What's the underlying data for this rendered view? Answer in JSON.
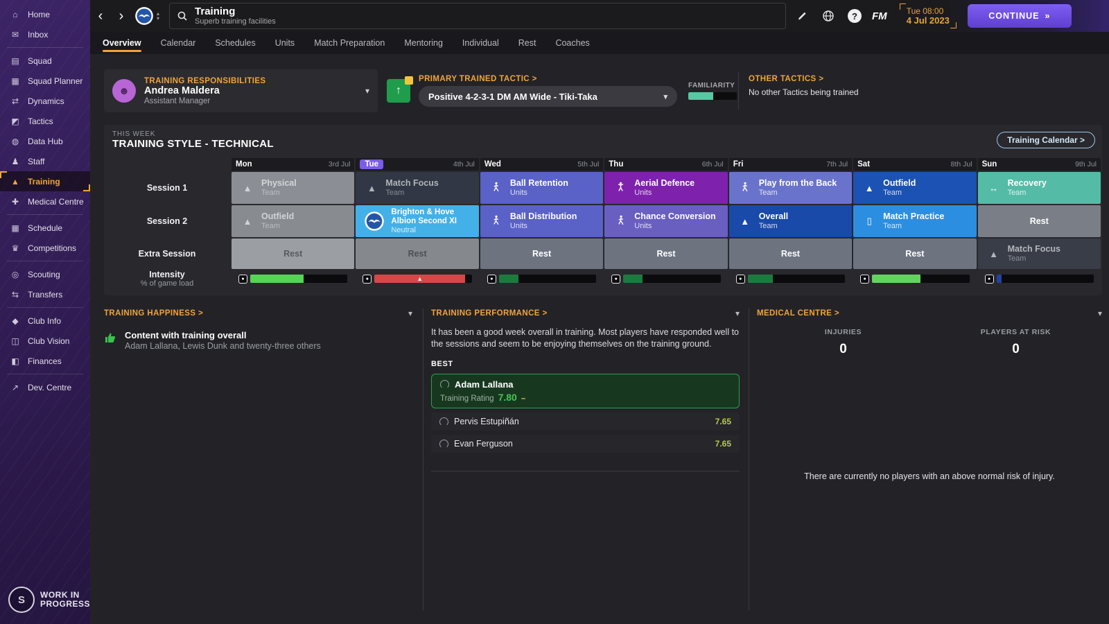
{
  "icons": {
    "back": "‹",
    "forward": "›",
    "up": "▴",
    "down": "▾",
    "chevdown": "▾",
    "cone": "▲",
    "swap": "↔",
    "tablet": "▯",
    "load": "●",
    "warn": "▲",
    "tactic_arrow": "↑",
    "avatar_people": "☻",
    "familiarity": "▪"
  },
  "sidebar": {
    "items": [
      {
        "icon": "⌂",
        "label": "Home"
      },
      {
        "icon": "✉",
        "label": "Inbox"
      },
      {
        "icon": "▤",
        "label": "Squad"
      },
      {
        "icon": "▦",
        "label": "Squad Planner"
      },
      {
        "icon": "⇄",
        "label": "Dynamics"
      },
      {
        "icon": "◩",
        "label": "Tactics"
      },
      {
        "icon": "◍",
        "label": "Data Hub"
      },
      {
        "icon": "♟",
        "label": "Staff"
      },
      {
        "icon": "▲",
        "label": "Training"
      },
      {
        "icon": "✚",
        "label": "Medical Centre"
      },
      {
        "icon": "▦",
        "label": "Schedule"
      },
      {
        "icon": "♛",
        "label": "Competitions"
      },
      {
        "icon": "◎",
        "label": "Scouting"
      },
      {
        "icon": "⇆",
        "label": "Transfers"
      },
      {
        "icon": "◆",
        "label": "Club Info"
      },
      {
        "icon": "◫",
        "label": "Club Vision"
      },
      {
        "icon": "◧",
        "label": "Finances"
      },
      {
        "icon": "↗",
        "label": "Dev. Centre"
      }
    ]
  },
  "wip": {
    "badge": "S",
    "line1": "WORK IN",
    "line2": "PROGRESS"
  },
  "topbar": {
    "title": "Training",
    "subtitle": "Superb training facilities",
    "fm_label": "FM",
    "help_label": "?",
    "clock": "Tue 08:00",
    "date": "4 Jul 2023",
    "continue_label": "CONTINUE",
    "continue_arrows": "»"
  },
  "tabs": [
    "Overview",
    "Calendar",
    "Schedules",
    "Units",
    "Match Preparation",
    "Mentoring",
    "Individual",
    "Rest",
    "Coaches"
  ],
  "responsibilities": {
    "heading": "TRAINING RESPONSIBILITIES",
    "name": "Andrea Maldera",
    "role": "Assistant Manager"
  },
  "tactic": {
    "heading": "PRIMARY TRAINED TACTIC >",
    "value": "Positive 4-2-3-1 DM AM Wide - Tiki-Taka",
    "familiarity_label": "FAMILIARITY",
    "familiarity_pct": "52%",
    "familiarity_color": "#57c8a1"
  },
  "other_tactics": {
    "heading": "OTHER TACTICS >",
    "text": "No other Tactics being trained"
  },
  "week": {
    "eyebrow": "THIS WEEK",
    "title": "TRAINING STYLE - TECHNICAL",
    "calendar_button": "Training Calendar >",
    "row_labels": {
      "s1": "Session 1",
      "s2": "Session 2",
      "extra": "Extra Session",
      "intensity": "Intensity",
      "intensity_sub": "% of game load"
    },
    "days": [
      {
        "name": "Mon",
        "date": "3rd Jul",
        "s1": {
          "title": "Physical",
          "sub": "Team",
          "icon": "cone",
          "color": "#8b8e94"
        },
        "s2": {
          "title": "Outfield",
          "sub": "Team",
          "icon": "cone",
          "color": "#888b90"
        },
        "extra": {
          "title": "Rest",
          "color": "#9b9ea3"
        },
        "intensity": {
          "pct": "55%",
          "color": "#55d455",
          "warn": ""
        }
      },
      {
        "name": "Tue",
        "date": "4th Jul",
        "s1": {
          "title": "Match Focus",
          "sub": "Team",
          "icon": "cone",
          "color": "#313744"
        },
        "s2": {
          "title": "Brighton & Hove Albion Second XI",
          "sub": "Neutral",
          "icon": "club-badge",
          "color": "#44b0e8"
        },
        "extra": {
          "title": "Rest",
          "color": "#85888d"
        },
        "intensity": {
          "pct": "93%",
          "color": "#d64848",
          "warn": "▲"
        }
      },
      {
        "name": "Wed",
        "date": "5th Jul",
        "s1": {
          "title": "Ball Retention",
          "sub": "Units",
          "icon": "runner",
          "color": "#5a61c7"
        },
        "s2": {
          "title": "Ball Distribution",
          "sub": "Units",
          "icon": "runner",
          "color": "#5a61c7"
        },
        "extra": {
          "title": "Rest",
          "color": "#6d7480"
        },
        "intensity": {
          "pct": "20%",
          "color": "#1d7a3e",
          "warn": ""
        }
      },
      {
        "name": "Thu",
        "date": "6th Jul",
        "s1": {
          "title": "Aerial Defence",
          "sub": "Units",
          "icon": "jumper",
          "color": "#7e22ad"
        },
        "s2": {
          "title": "Chance Conversion",
          "sub": "Units",
          "icon": "runner",
          "color": "#695fc1"
        },
        "extra": {
          "title": "Rest",
          "color": "#6d7480"
        },
        "intensity": {
          "pct": "20%",
          "color": "#1d7a3e",
          "warn": ""
        }
      },
      {
        "name": "Fri",
        "date": "7th Jul",
        "s1": {
          "title": "Play from the Back",
          "sub": "Team",
          "icon": "runner",
          "color": "#6a73cb"
        },
        "s2": {
          "title": "Overall",
          "sub": "Team",
          "icon": "cone",
          "color": "#1949a9"
        },
        "extra": {
          "title": "Rest",
          "color": "#6d7480"
        },
        "intensity": {
          "pct": "26%",
          "color": "#1d7a3e",
          "warn": ""
        }
      },
      {
        "name": "Sat",
        "date": "8th Jul",
        "s1": {
          "title": "Outfield",
          "sub": "Team",
          "icon": "cone",
          "color": "#1b52b3"
        },
        "s2": {
          "title": "Match Practice",
          "sub": "Team",
          "icon": "tablet",
          "color": "#2c8ee1"
        },
        "extra": {
          "title": "Rest",
          "color": "#6d7480"
        },
        "intensity": {
          "pct": "50%",
          "color": "#62d45e",
          "warn": ""
        }
      },
      {
        "name": "Sun",
        "date": "9th Jul",
        "s1": {
          "title": "Recovery",
          "sub": "Team",
          "icon": "swap",
          "color": "#54bca6"
        },
        "s2": {
          "title": "Rest",
          "color": "#7a7f87"
        },
        "extra": {
          "title": "Match Focus",
          "sub": "Team",
          "icon": "cone",
          "color": "#383d48"
        },
        "intensity": {
          "pct": "5%",
          "color": "#24429e",
          "warn": ""
        }
      }
    ]
  },
  "happiness": {
    "heading": "TRAINING HAPPINESS >",
    "item_title": "Content with training overall",
    "item_sub": "Adam Lallana, Lewis Dunk and twenty-three others"
  },
  "performance": {
    "heading": "TRAINING PERFORMANCE >",
    "summary": "It has been a good week overall in training. Most players have responded well to the sessions and seem to be enjoying themselves on the training ground.",
    "best_label": "BEST",
    "best": {
      "name": "Adam Lallana",
      "rating_label": "Training Rating",
      "rating": "7.80",
      "trend": "–"
    },
    "others": [
      {
        "name": "Pervis Estupiñán",
        "rating": "7.65"
      },
      {
        "name": "Evan Ferguson",
        "rating": "7.65"
      }
    ]
  },
  "medical": {
    "heading": "MEDICAL CENTRE >",
    "injuries_label": "INJURIES",
    "injuries": "0",
    "risk_label": "PLAYERS AT RISK",
    "risk": "0",
    "note": "There are currently no players with an above normal risk of injury."
  }
}
